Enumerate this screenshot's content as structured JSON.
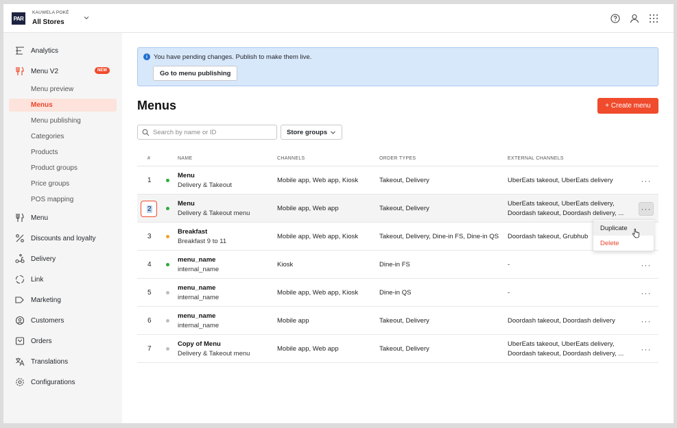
{
  "topbar": {
    "logo_text": "PAR",
    "brand_small": "KAUWELA POKÉ",
    "brand_big": "All Stores"
  },
  "sidebar": {
    "analytics": "Analytics",
    "menu_v2": "Menu V2",
    "new_badge": "NEW",
    "sub_items": [
      "Menu preview",
      "Menus",
      "Menu publishing",
      "Categories",
      "Products",
      "Product groups",
      "Price groups",
      "POS mapping"
    ],
    "menu": "Menu",
    "discounts": "Discounts and loyalty",
    "delivery": "Delivery",
    "link": "Link",
    "marketing": "Marketing",
    "customers": "Customers",
    "orders": "Orders",
    "translations": "Translations",
    "configurations": "Configurations"
  },
  "banner": {
    "info_icon": "i",
    "text": "You have pending changes. Publish to make them live.",
    "button": "Go to menu publishing"
  },
  "page": {
    "title": "Menus",
    "create_button": "+ Create menu",
    "search_placeholder": "Search by name or ID",
    "store_groups": "Store groups"
  },
  "table": {
    "headers": [
      "#",
      "NAME",
      "CHANNELS",
      "ORDER TYPES",
      "EXTERNAL CHANNELS"
    ],
    "more_label": "···",
    "rows": [
      {
        "num": "1",
        "status": "green",
        "name": "Menu",
        "desc": "Delivery & Takeout",
        "channels": "Mobile app, Web app, Kiosk",
        "order_types": "Takeout, Delivery",
        "ext1": "UberEats takeout, UberEats delivery",
        "ext2": ""
      },
      {
        "num": "2",
        "status": "green",
        "name": "Menu",
        "desc": "Delivery & Takeout menu",
        "channels": "Mobile app, Web app",
        "order_types": "Takeout, Delivery",
        "ext1": "UberEats takeout, UberEats delivery,",
        "ext2": "Doordash takeout, Doordash delivery, ..."
      },
      {
        "num": "3",
        "status": "orange",
        "name": "Breakfast",
        "desc": "Breakfast 9 to 11",
        "channels": "Mobile app, Web app, Kiosk",
        "order_types": "Takeout, Delivery, Dine-in FS, Dine-in QS",
        "ext1": "Doordash takeout, Grubhub",
        "ext2": ""
      },
      {
        "num": "4",
        "status": "green",
        "name": "menu_name",
        "desc": "internal_name",
        "channels": "Kiosk",
        "order_types": "Dine-in FS",
        "ext1": "-",
        "ext2": ""
      },
      {
        "num": "5",
        "status": "gray",
        "name": "menu_name",
        "desc": "internal_name",
        "channels": "Mobile app, Web app, Kiosk",
        "order_types": "Dine-in QS",
        "ext1": "-",
        "ext2": ""
      },
      {
        "num": "6",
        "status": "gray",
        "name": "menu_name",
        "desc": "internal_name",
        "channels": "Mobile app",
        "order_types": "Takeout, Delivery",
        "ext1": "Doordash takeout, Doordash delivery",
        "ext2": ""
      },
      {
        "num": "7",
        "status": "gray",
        "name": "Copy of Menu",
        "desc": "Delivery & Takeout menu",
        "channels": "Mobile app, Web app",
        "order_types": "Takeout, Delivery",
        "ext1": "UberEats takeout, UberEats delivery,",
        "ext2": "Doordash takeout, Doordash delivery, ..."
      }
    ]
  },
  "dropdown": {
    "duplicate": "Duplicate",
    "delete": "Delete"
  },
  "colors": {
    "accent": "#ef4b2c",
    "green": "#2eaa3c",
    "orange": "#f5a02a",
    "gray": "#bdbdbd"
  }
}
